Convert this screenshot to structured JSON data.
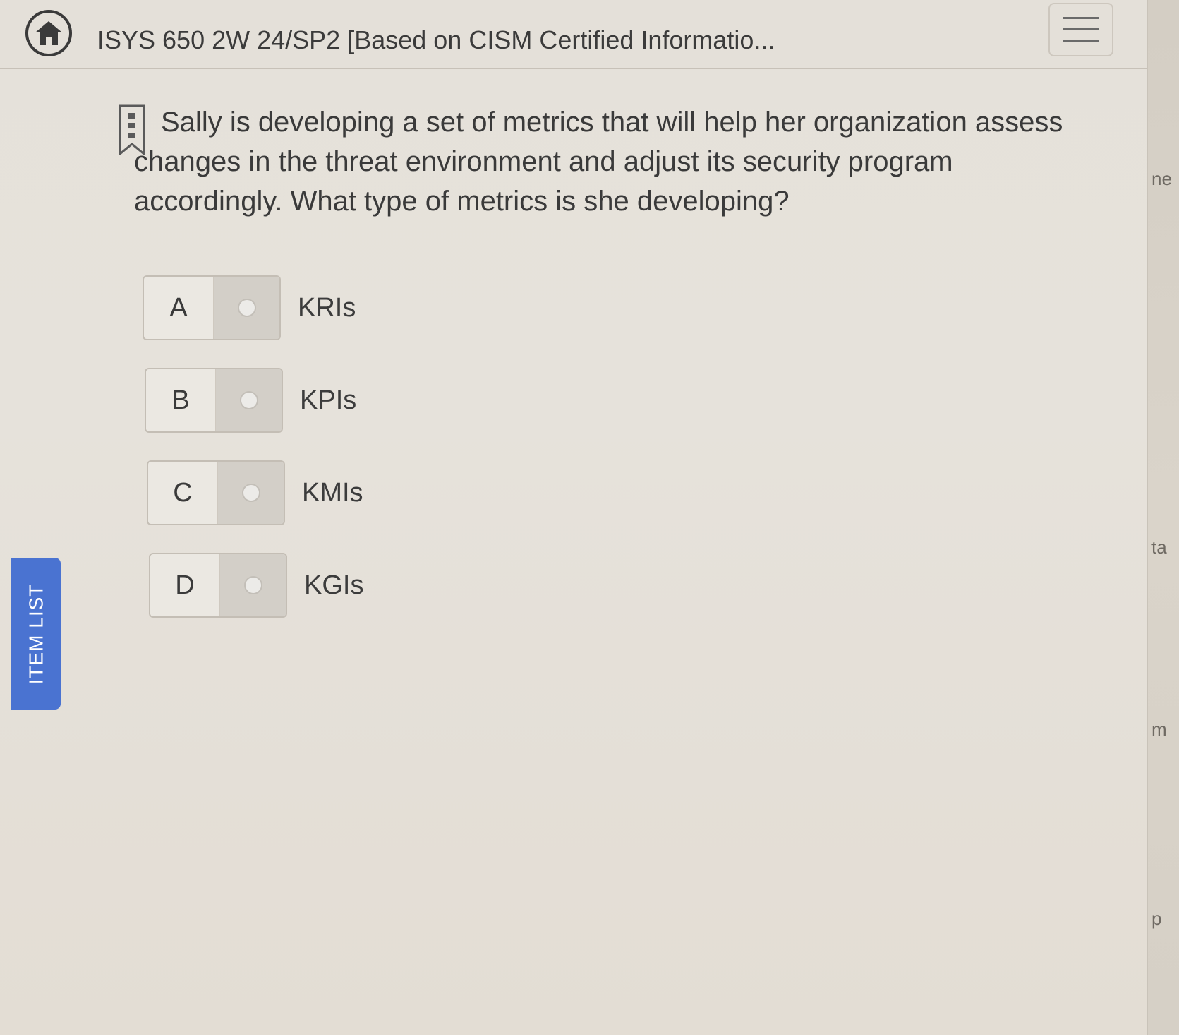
{
  "header": {
    "title": "ISYS 650 2W 24/SP2 [Based on CISM Certified Informatio..."
  },
  "question": {
    "text": "Sally is developing a set of metrics that will help her organization assess changes in the threat environment and adjust its security program accordingly. What type of metrics is she developing?"
  },
  "options": [
    {
      "letter": "A",
      "label": "KRIs"
    },
    {
      "letter": "B",
      "label": "KPIs"
    },
    {
      "letter": "C",
      "label": "KMIs"
    },
    {
      "letter": "D",
      "label": "KGIs"
    }
  ],
  "sidebar": {
    "item_list_label": "ITEM LIST"
  },
  "background_fragments": [
    "ne",
    "ta",
    "m",
    "p"
  ],
  "colors": {
    "item_list_tab": "#4a73d1",
    "text": "#3a3a3a"
  },
  "icons": {
    "home": "home-icon",
    "menu": "hamburger-menu-icon",
    "bookmark": "bookmark-flag-icon"
  }
}
